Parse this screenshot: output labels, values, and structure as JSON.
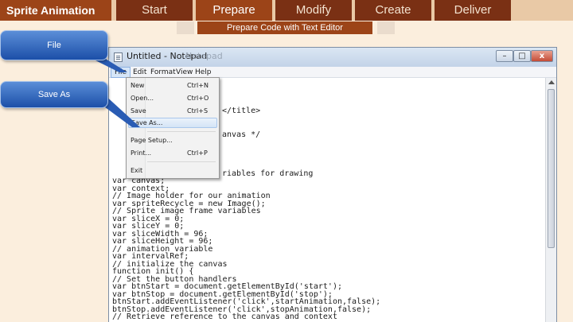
{
  "nav": {
    "title": "Sprite Animation",
    "items": [
      {
        "label": "Start"
      },
      {
        "label": "Prepare"
      },
      {
        "label": "Modify"
      },
      {
        "label": "Create"
      },
      {
        "label": "Deliver"
      }
    ],
    "active": "Prepare"
  },
  "banner": "Prepare Code with Text Editor",
  "callouts": {
    "file": "File",
    "save_as": "Save As"
  },
  "window": {
    "title": "Untitled - Notepad",
    "title_ghost": "Notepad",
    "controls": {
      "minimize": "–",
      "maximize": "□",
      "close": "x"
    }
  },
  "menubar": [
    "File",
    "Edit",
    "Format",
    "View",
    "Help"
  ],
  "file_menu": [
    {
      "label": "New",
      "shortcut": "Ctrl+N"
    },
    {
      "label": "Open...",
      "shortcut": "Ctrl+O"
    },
    {
      "label": "Save",
      "shortcut": "Ctrl+S"
    },
    {
      "label": "Save As...",
      "shortcut": ""
    },
    {
      "label": "Page Setup...",
      "shortcut": ""
    },
    {
      "label": "Print...",
      "shortcut": "Ctrl+P"
    },
    {
      "label": "Exit",
      "shortcut": ""
    }
  ],
  "code_fragments": {
    "title_tag": "</title>",
    "canvas_comment": "anvas */",
    "vars_comment": "riables for drawing"
  },
  "code_lines": [
    "var canvas;",
    "var context;",
    "// Image holder for our animation",
    "var spriteRecycle = new Image();",
    "// Sprite image frame variables",
    "var sliceX = 0;",
    "var sliceY = 0;",
    "var sliceWidth = 96;",
    "var sliceHeight = 96;",
    "// animation variable",
    "var intervalRef;",
    "// initialize the canvas",
    "function init() {",
    "// Set the button handlers",
    "var btnStart = document.getElementById('start');",
    "var btnStop = document.getElementById('stop');",
    "btnStart.addEventListener('click',startAnimation,false);",
    "btnStop.addEventListener('click',stopAnimation,false);",
    "// Retrieve reference to the canvas and context"
  ],
  "colors": {
    "nav_dark": "#7a3014",
    "nav_active": "#9c4418",
    "callout_blue": "#1c4fa8",
    "page_bg": "#fbeedd"
  }
}
